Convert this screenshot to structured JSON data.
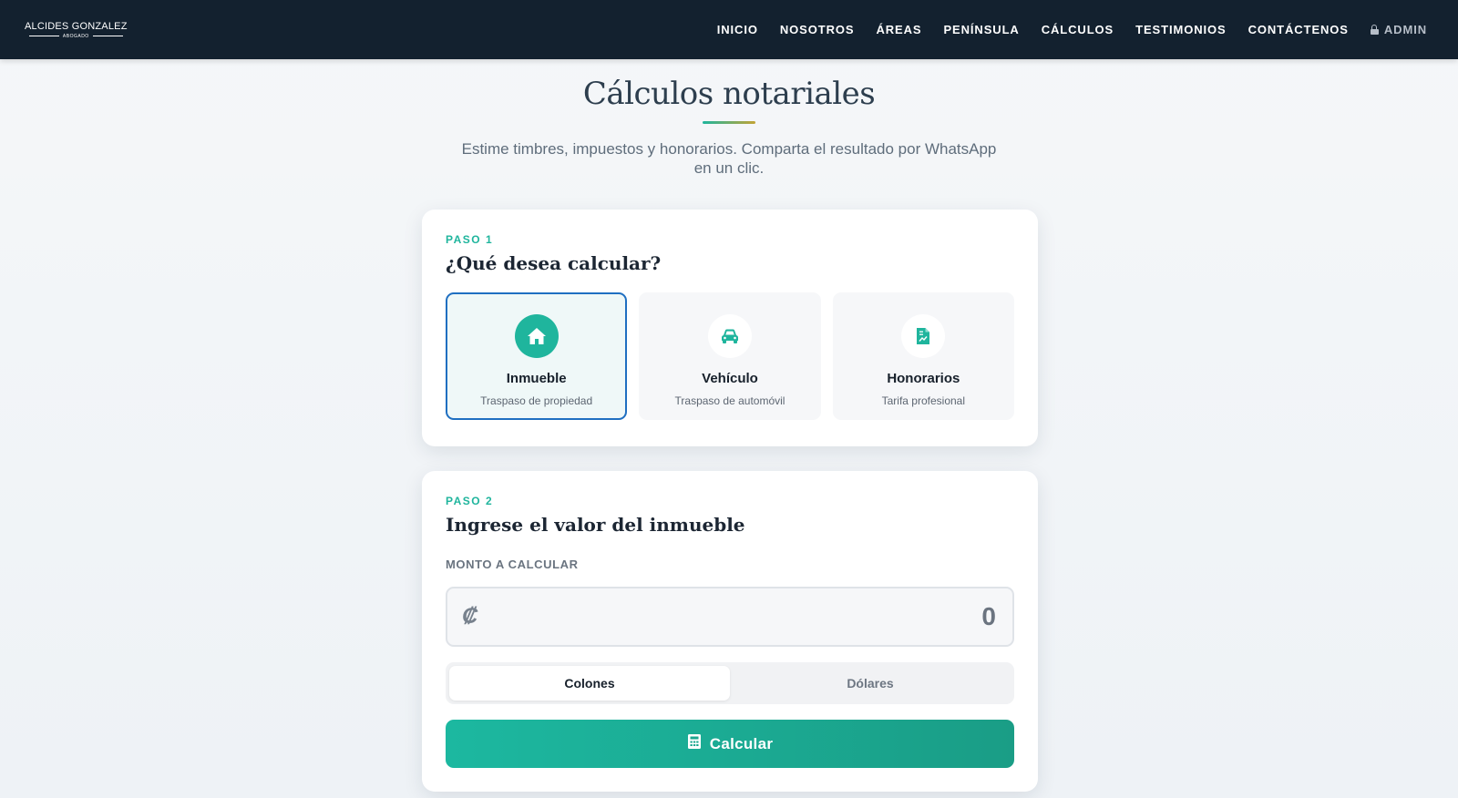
{
  "brand": {
    "name": "ALCIDES GONZALEZ",
    "tagline": "ABOGADO"
  },
  "nav": {
    "items": [
      "INICIO",
      "NOSOTROS",
      "ÁREAS",
      "PENÍNSULA",
      "CÁLCULOS",
      "TESTIMONIOS",
      "CONTÁCTENOS"
    ],
    "admin_label": "ADMIN"
  },
  "hero": {
    "title": "Cálculos notariales",
    "subtitle": "Estime timbres, impuestos y honorarios. Comparta el resultado por WhatsApp en un clic."
  },
  "step1": {
    "label": "PASO 1",
    "title": "¿Qué desea calcular?",
    "options": [
      {
        "title": "Inmueble",
        "subtitle": "Traspaso de propiedad",
        "icon": "house-icon",
        "selected": true
      },
      {
        "title": "Vehículo",
        "subtitle": "Traspaso de automóvil",
        "icon": "car-icon",
        "selected": false
      },
      {
        "title": "Honorarios",
        "subtitle": "Tarifa profesional",
        "icon": "invoice-icon",
        "selected": false
      }
    ]
  },
  "step2": {
    "label": "PASO 2",
    "title": "Ingrese el valor del inmueble",
    "amount_label": "MONTO A CALCULAR",
    "currency_symbol": "₡",
    "amount_value": "0",
    "currencies": [
      "Colones",
      "Dólares"
    ],
    "selected_currency": "Colones",
    "calculate_label": "Calcular"
  },
  "colors": {
    "accent": "#1fb59d",
    "header": "#13212f",
    "selected_border": "#1f6fc1"
  }
}
